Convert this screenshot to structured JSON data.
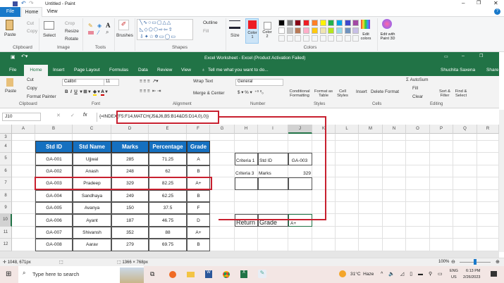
{
  "paint": {
    "title": "Untitled - Paint",
    "tabs": [
      "File",
      "Home",
      "View"
    ],
    "clipboard": {
      "paste": "Paste",
      "cut": "Cut",
      "copy": "Copy",
      "label": "Clipboard"
    },
    "image": {
      "select": "Select",
      "crop": "Crop",
      "resize": "Resize",
      "rotate": "Rotate",
      "label": "Image"
    },
    "tools": {
      "label": "Tools"
    },
    "brushes": "Brushes",
    "shapes": {
      "outline": "Outline",
      "fill": "Fill",
      "label": "Shapes"
    },
    "size": "Size",
    "color1": "Color 1",
    "color2": "Color 2",
    "colors_label": "Colors",
    "palette": [
      "#000000",
      "#7f7f7f",
      "#880015",
      "#ed1c24",
      "#ff7f27",
      "#fff200",
      "#22b14c",
      "#00a2e8",
      "#3f48cc",
      "#a349a4",
      "#ffffff",
      "#c3c3c3",
      "#b97a57",
      "#ffaec9",
      "#ffc90e",
      "#efe4b0",
      "#b5e61d",
      "#99d9ea",
      "#7092be",
      "#c8bfe7"
    ],
    "color1_value": "#ed1c24",
    "color2_value": "#ffffff",
    "edit_colors": "Edit colors",
    "paint3d": "Edit with Paint 3D",
    "status": {
      "cursor": "1048, 671px",
      "canvas": "1366 × 768px",
      "zoom": "100%"
    }
  },
  "excel": {
    "title": "Excel Worksheet - Excel (Product Activation Failed)",
    "tabs": [
      "File",
      "Home",
      "Insert",
      "Page Layout",
      "Formulas",
      "Data",
      "Review",
      "View"
    ],
    "tell_me": "Tell me what you want to do...",
    "user": "Shuchita Saxena",
    "share": "Share",
    "ribbon": {
      "cut": "Cut",
      "copy": "Copy",
      "format_painter": "Format Painter",
      "paste": "Paste",
      "clipboard": "Clipboard",
      "font_name": "Calibri",
      "font_size": "11",
      "font": "Font",
      "wrap": "Wrap Text",
      "merge": "Merge & Center",
      "alignment": "Alignment",
      "number_format": "General",
      "number": "Number",
      "cond": "Conditional Formatting",
      "fmt_table": "Format as Table",
      "cell_styles": "Cell Styles",
      "styles": "Styles",
      "insert": "Insert",
      "delete": "Delete",
      "format": "Format",
      "cells": "Cells",
      "autosum": "AutoSum",
      "fill": "Fill",
      "clear": "Clear",
      "sort": "Sort & Filter",
      "find": "Find & Select",
      "editing": "Editing"
    },
    "name_box": "J10",
    "formula": "{=INDEX(F5:F14,MATCH(J5&J6,B5:B14&D5:D14,0),0)}",
    "columns": [
      "A",
      "B",
      "C",
      "D",
      "E",
      "F",
      "G",
      "H",
      "I",
      "J",
      "K",
      "L",
      "M",
      "N",
      "O",
      "P",
      "Q",
      "R"
    ],
    "rows": [
      "3",
      "4",
      "5",
      "6",
      "7",
      "8",
      "9",
      "10",
      "11",
      "12"
    ],
    "table": {
      "headers": [
        "Std ID",
        "Std Name",
        "Marks",
        "Percentage",
        "Grade"
      ],
      "rows": [
        [
          "GA-001",
          "Ujjwal",
          "285",
          "71.25",
          "A"
        ],
        [
          "GA-002",
          "Anash",
          "248",
          "62",
          "B"
        ],
        [
          "GA-003",
          "Pradeep",
          "329",
          "82.25",
          "A+"
        ],
        [
          "GA-004",
          "Sandhaya",
          "249",
          "62.25",
          "B"
        ],
        [
          "GA-005",
          "Avanya",
          "150",
          "37.5",
          "F"
        ],
        [
          "GA-006",
          "Ayant",
          "187",
          "46.75",
          "D"
        ],
        [
          "GA-007",
          "Shivansh",
          "352",
          "88",
          "A+"
        ],
        [
          "GA-008",
          "Aarav",
          "279",
          "69.75",
          "B"
        ]
      ]
    },
    "criteria": [
      {
        "h": "Criteria 1",
        "i": "Std ID",
        "j": "GA-003"
      },
      {
        "h": "Criteria 3",
        "i": "Marks",
        "j": "329"
      }
    ],
    "result": {
      "h": "Return",
      "i": "Grade",
      "j": "A+"
    }
  },
  "taskbar": {
    "search": "Type here to search",
    "weather": "31°C  Haze",
    "lang1": "ENG",
    "lang2": "US",
    "time": "6:13 PM",
    "date": "2/26/2023"
  }
}
